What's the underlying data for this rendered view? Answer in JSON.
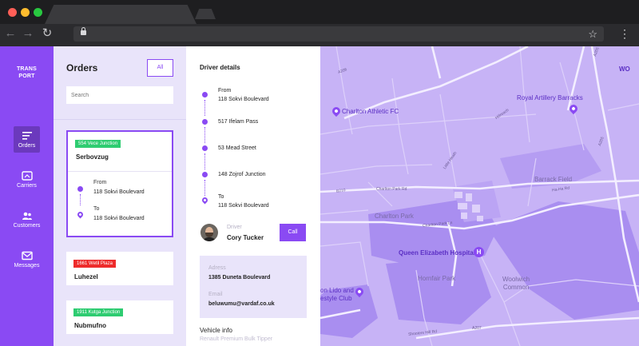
{
  "sidebar": {
    "logo": "TRANS\nPORT",
    "items": [
      {
        "label": "Orders",
        "icon": "orders-icon"
      },
      {
        "label": "Carriers",
        "icon": "carriers-icon"
      },
      {
        "label": "Customers",
        "icon": "customers-icon"
      },
      {
        "label": "Messages",
        "icon": "messages-icon"
      }
    ]
  },
  "orders": {
    "title": "Orders",
    "filter_label": "All",
    "search_placeholder": "Search",
    "cards": [
      {
        "badge": "554 Vece Junction",
        "badge_color": "#2ecc71",
        "name": "Serbovzug",
        "from_label": "From",
        "from_addr": "118 Sokvi Boulevard",
        "to_label": "To",
        "to_addr": "118 Sokvi Boulevard"
      },
      {
        "badge": "1661 Wetil Plaza",
        "badge_color": "#ee2b2b",
        "name": "Luhezel"
      },
      {
        "badge": "1911 Kutga Junction",
        "badge_color": "#2ecc71",
        "name": "Nubmufno"
      }
    ]
  },
  "driver_details": {
    "title": "Driver details",
    "stops": [
      {
        "label": "From",
        "addr": "118 Sokvi Boulevard"
      },
      {
        "addr": "517 Ifelam Pass"
      },
      {
        "addr": "53 Mead Street"
      },
      {
        "addr": "148 Zojrof Junction"
      },
      {
        "label": "To",
        "addr": "118 Sokvi Boulevard"
      }
    ],
    "driver_label": "Driver",
    "driver_name": "Cory Tucker",
    "call_label": "Call",
    "address_label": "Adress",
    "address_value": "1385 Duneta Boulevard",
    "email_label": "Email",
    "email_value": "beluwumu@vardaf.co.uk",
    "vehicle_title": "Vehicle info",
    "vehicle_sub": "Renault Premium Bulk Tipper"
  },
  "map": {
    "labels": {
      "charlton_athletic": "Charlton Athletic FC",
      "royal_artillery": "Royal Artillery Barracks",
      "barrack_field": "Barrack Field",
      "charlton_park": "Charlton Park",
      "queen_elizabeth": "Queen Elizabeth Hospital",
      "hornfair_park": "Hornfair Park",
      "woolwich_common": "Woolwich\nCommon",
      "lido_1": "on Lido and",
      "lido_2": "estyle Club",
      "wo": "WO"
    },
    "roads": {
      "a206": "A206",
      "a205_top": "A205",
      "a205_right": "A205",
      "b210": "B210",
      "charlton_park_rd": "Charlton Park Rd",
      "charlton_park_ln": "Charlton Park Ln",
      "little_heath": "Little Heath",
      "hillreach": "Hillreach",
      "ha_ha_rd": "Ha-Ha Rd",
      "shooters_hill": "Shooters Hill Rd",
      "a207": "A207"
    }
  },
  "colors": {
    "accent": "#8a4af3",
    "panel": "#e9e4fa",
    "map": "#c7b3f6"
  }
}
